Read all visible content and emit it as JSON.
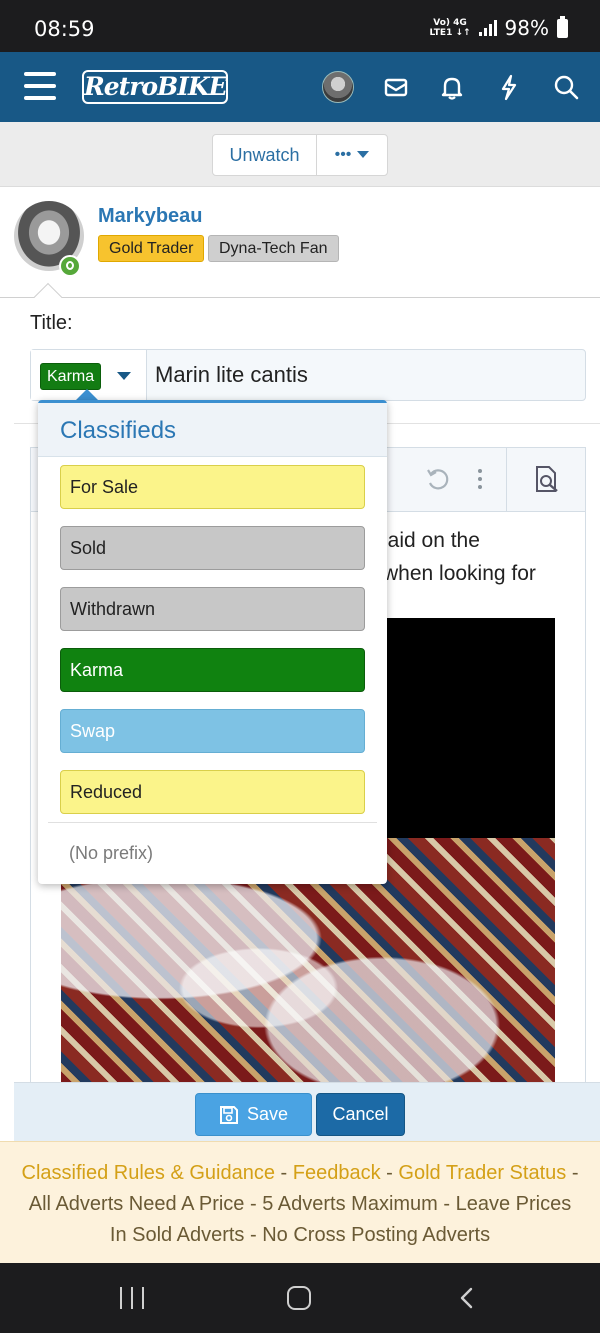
{
  "status_bar": {
    "time": "08:59",
    "network_line1": "Vo) 4G",
    "network_line2": "LTE1 ↓↑",
    "battery": "98%"
  },
  "header": {
    "logo_text": "RetroBIKE",
    "icons": [
      "menu-icon",
      "avatar",
      "mail-icon",
      "bell-icon",
      "lightning-icon",
      "search-icon"
    ]
  },
  "thread_actions": {
    "unwatch_label": "Unwatch",
    "more_label": "•••"
  },
  "user": {
    "name": "Markybeau",
    "badges": [
      "Gold Trader",
      "Dyna-Tech Fan"
    ]
  },
  "form": {
    "title_label": "Title:",
    "selected_prefix": "Karma",
    "title_value": "Marin lite cantis",
    "editor_text_line1": "laid on the",
    "editor_text_line2": "when looking for"
  },
  "prefix_menu": {
    "heading": "Classifieds",
    "options": [
      "For Sale",
      "Sold",
      "Withdrawn",
      "Karma",
      "Swap",
      "Reduced"
    ],
    "no_prefix": "(No prefix)"
  },
  "buttons": {
    "save": "Save",
    "cancel": "Cancel"
  },
  "notice": {
    "links": [
      "Classified Rules & Guidance",
      "Feedback",
      "Gold Trader Status"
    ],
    "rules": [
      "All Adverts Need A Price",
      "5 Adverts Maximum",
      "Leave Prices In Sold Adverts",
      "No Cross Posting Adverts"
    ],
    "separator": " - "
  },
  "colors": {
    "header_bg": "#185886",
    "accent": "#2b77b4",
    "karma": "#108210",
    "gold_trader": "#f7c32e"
  }
}
